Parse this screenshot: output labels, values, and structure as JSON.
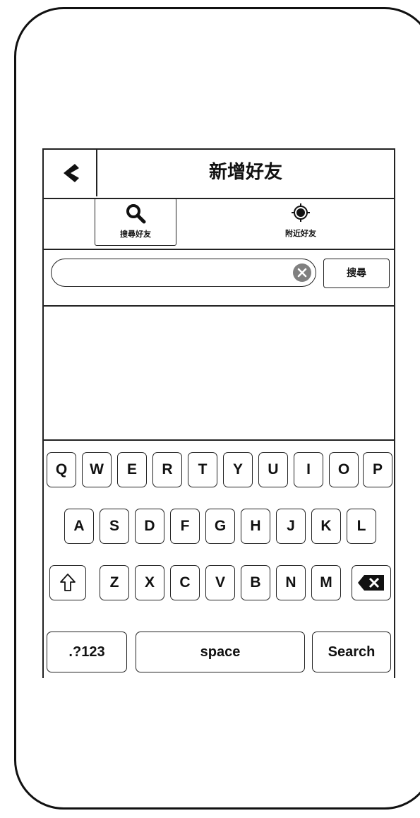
{
  "header": {
    "title": "新增好友"
  },
  "tabs": [
    {
      "label": "搜尋好友",
      "icon": "search-icon",
      "active": true
    },
    {
      "label": "附近好友",
      "icon": "location-target-icon",
      "active": false
    }
  ],
  "search": {
    "value": "",
    "placeholder": "",
    "button_label": "搜尋"
  },
  "keyboard": {
    "row1": [
      "Q",
      "W",
      "E",
      "R",
      "T",
      "Y",
      "U",
      "I",
      "O",
      "P"
    ],
    "row2": [
      "A",
      "S",
      "D",
      "F",
      "G",
      "H",
      "J",
      "K",
      "L"
    ],
    "row3": [
      "Z",
      "X",
      "C",
      "V",
      "B",
      "N",
      "M"
    ],
    "shift_icon": "shift-icon",
    "backspace_icon": "backspace-icon",
    "numbers_label": ".?123",
    "space_label": "space",
    "search_label": "Search"
  }
}
